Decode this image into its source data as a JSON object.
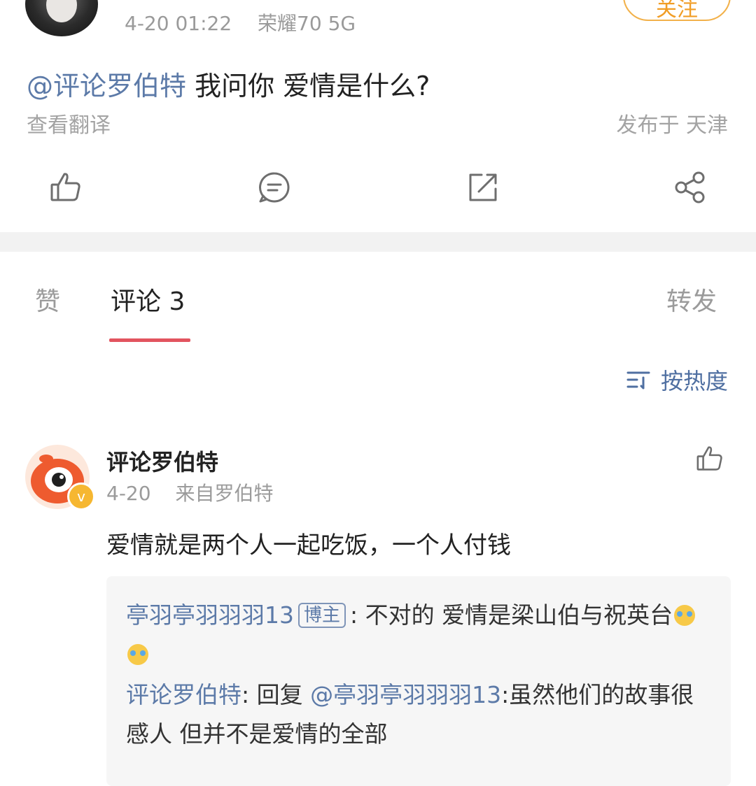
{
  "post": {
    "timestamp": "4-20 01:22",
    "device": "荣耀70 5G",
    "follow_label": "关注",
    "mention": "@评论罗伯特",
    "body": " 我问你  爱情是什么?",
    "translate_label": "查看翻译",
    "location": "发布于 天津",
    "actions": [
      "like-icon",
      "comment-icon",
      "repost-icon",
      "share-icon"
    ]
  },
  "tabs": {
    "likes": "赞",
    "comments": "评论 3",
    "reposts": "转发"
  },
  "sort": {
    "label": "按热度"
  },
  "comment": {
    "author": "评论罗伯特",
    "date": "4-20",
    "source": "来自罗伯特",
    "text": "爱情就是两个人一起吃饭，一个人付钱",
    "replies": [
      {
        "author": "亭羽亭羽羽羽13",
        "tag": "博主",
        "text": ": 不对的 爱情是梁山伯与祝英台"
      },
      {
        "author": "评论罗伯特",
        "sep": ": 回复 ",
        "mention": "@亭羽亭羽羽羽13",
        "text": ":虽然他们的故事很感人 但并不是爱情的全部"
      }
    ]
  },
  "colors": {
    "accent": "#e2545f",
    "link": "#5c7aa8",
    "follow": "#f19d25"
  }
}
